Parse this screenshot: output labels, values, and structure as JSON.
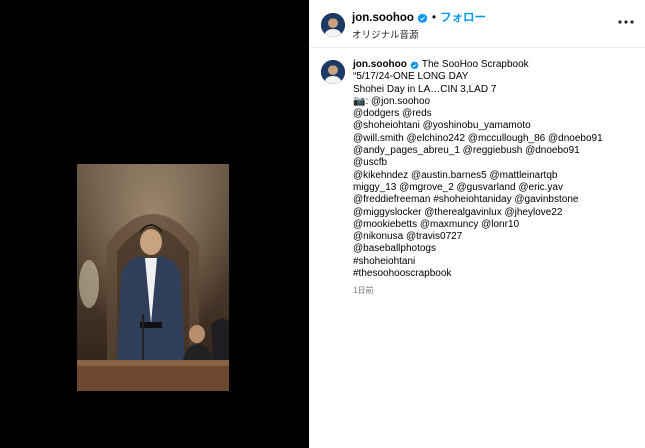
{
  "header": {
    "username": "jon.soohoo",
    "separator": "•",
    "follow_label": "フォロー",
    "audio_label": "オリジナル音源"
  },
  "caption": {
    "username": "jon.soohoo",
    "first_line_text": "The SooHoo Scrapbook",
    "lines": [
      "“5/17/24-ONE LONG DAY",
      "Shohei Day in LA…CIN 3,LAD 7",
      "📷: @jon.soohoo",
      "@dodgers @reds",
      "@shoheiohtani @yoshinobu_yamamoto",
      "@will.smith @elchino242 @mccullough_86 @dnoebo91",
      "@andy_pages_abreu_1 @reggiebush @dnoebo91",
      "@uscfb",
      "@kikehndez @austin.barnes5 @mattleinartqb",
      "miggy_13 @mgrove_2 @gusvarland @eric.yav",
      "@freddiefreeman #shoheiohtaniday @gavinbstone",
      "@miggyslocker @therealgavinlux @jheylove22",
      "@mookiebetts @maxmuncy @lonr10",
      "@nikonusa @travis0727",
      "@baseballphotogs",
      "#shoheiohtani",
      "#thesoohooscrapbook"
    ]
  },
  "timestamp": "1日前",
  "colors": {
    "follow_blue": "#0095f6",
    "verified_blue": "#0095f6",
    "timestamp_gray": "#737373"
  },
  "icons": {
    "verified": "verified-badge-icon",
    "more": "more-options-icon"
  }
}
